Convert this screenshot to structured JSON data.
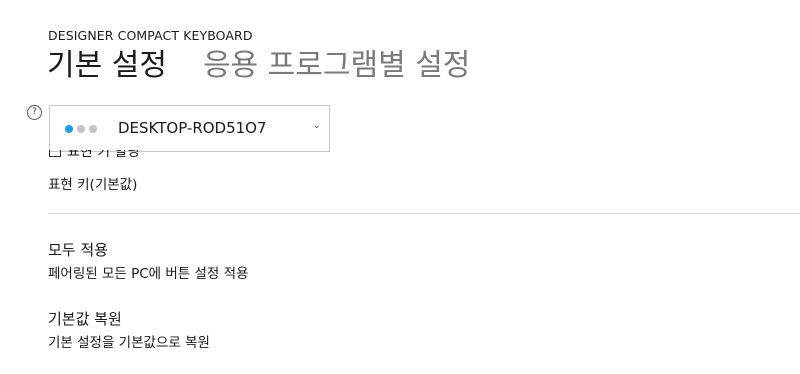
{
  "header": {
    "device_name": "DESIGNER COMPACT KEYBOARD",
    "tabs": [
      {
        "label": "기본 설정",
        "active": true
      },
      {
        "label": "응용 프로그램별 설정",
        "active": false
      }
    ]
  },
  "device_selector": {
    "help_icon": "?",
    "selected": "DESKTOP-ROD51O7",
    "connection_dots": 3,
    "accent_color": "#1ea0e8"
  },
  "settings": {
    "partial_row_label": "표현 키 할당",
    "key_sub": "표현 키(기본값)",
    "apply_all_title": "모두 적용",
    "apply_all_sub": "페어링된 모든 PC에 버튼 설정 적용",
    "restore_title": "기본값 복원",
    "restore_sub": "기본 설정을 기본값으로 복원"
  }
}
